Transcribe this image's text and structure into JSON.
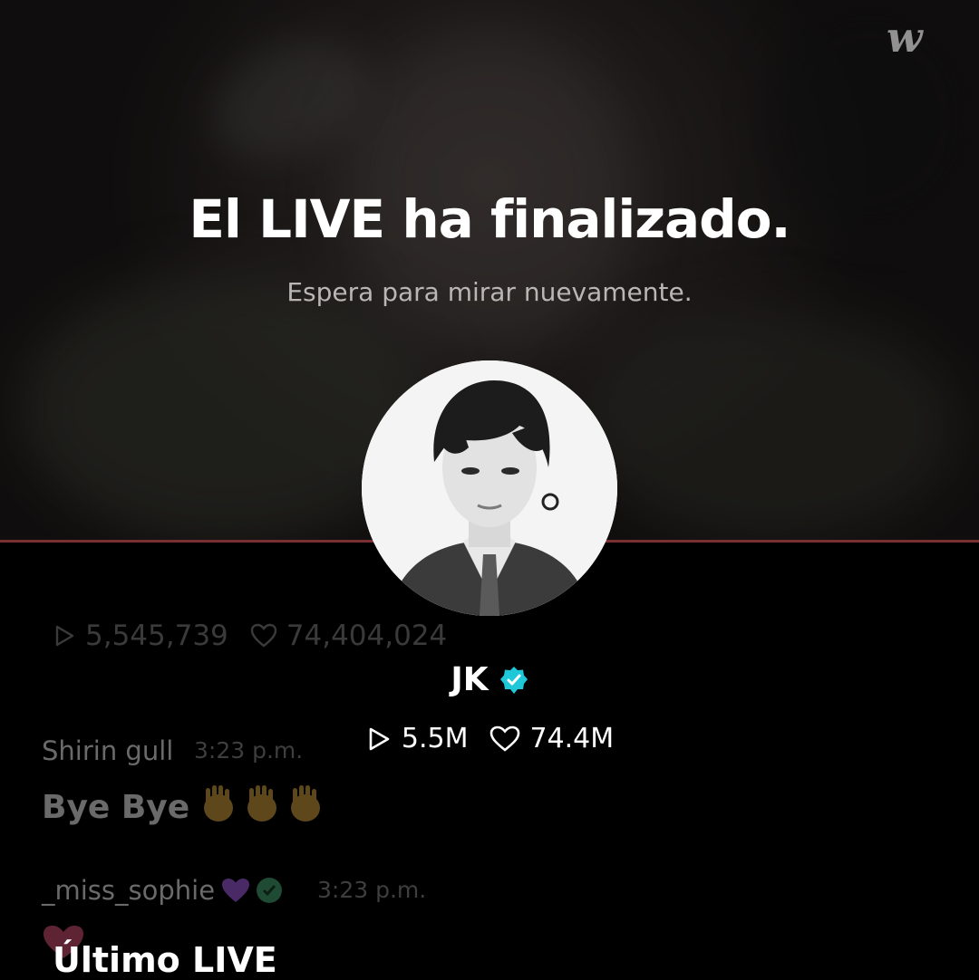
{
  "brand": {
    "logo_text": "w"
  },
  "live_end": {
    "title": "El LIVE ha finalizado.",
    "subtitle": "Espera para mirar nuevamente."
  },
  "background_chat": {
    "stats": {
      "plays": "5,545,739",
      "likes": "74,404,024"
    },
    "messages": [
      {
        "user": "Shirin gull",
        "time": "3:23 p.m.",
        "text": "Bye Bye"
      },
      {
        "user": "_miss_sophie",
        "time": "3:23 p.m."
      }
    ]
  },
  "profile": {
    "name": "JK",
    "plays": "5.5M",
    "likes": "74.4M",
    "verified_color": "#1ec8d8"
  },
  "section": {
    "last_live": "Último LIVE"
  },
  "colors": {
    "divider": "#7a2f33",
    "background": "#000000"
  }
}
